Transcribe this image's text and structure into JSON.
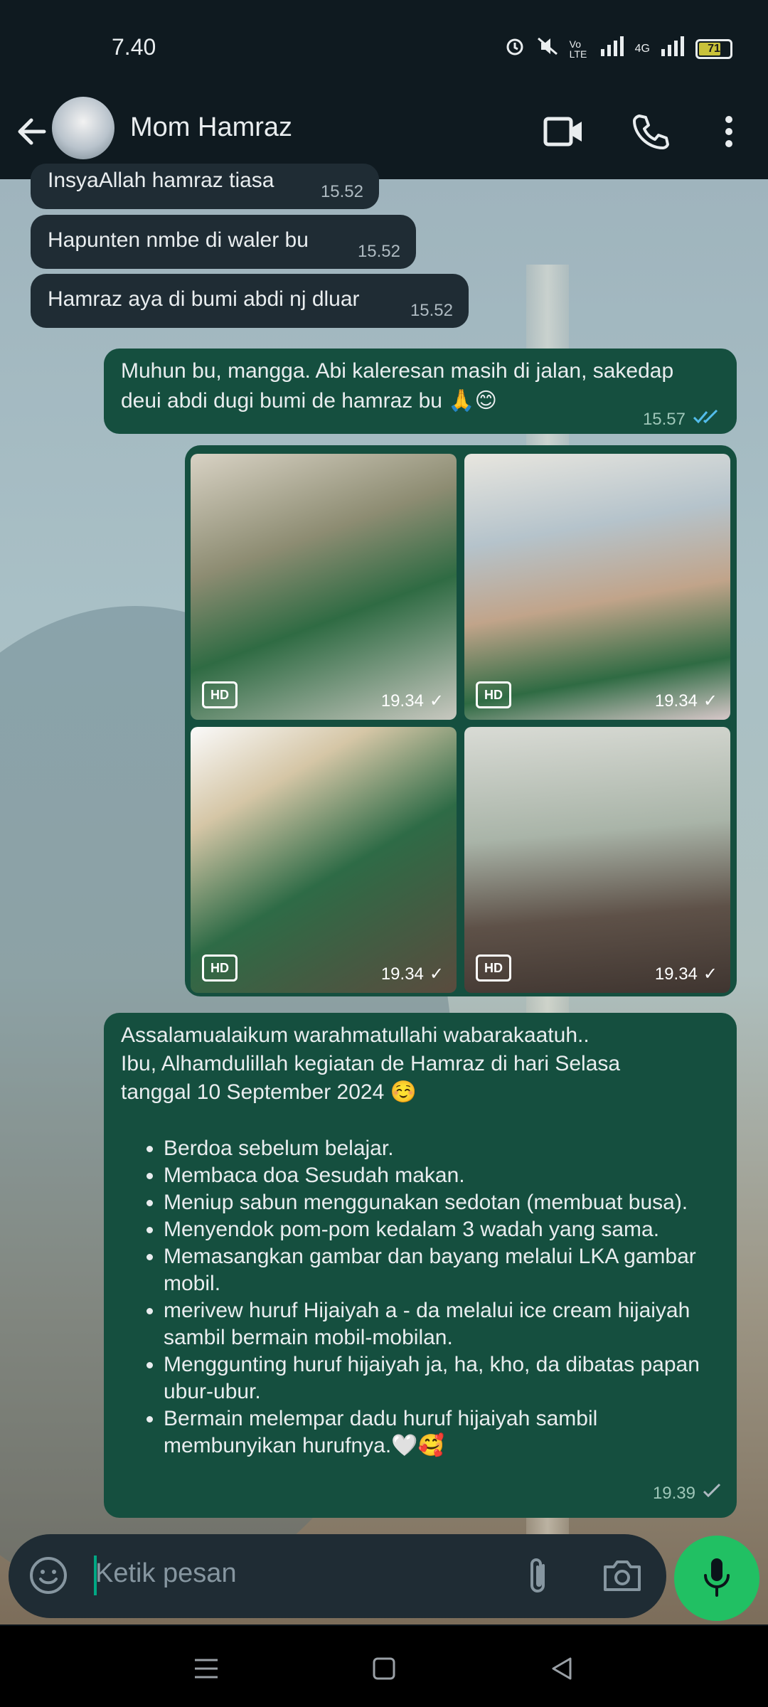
{
  "status": {
    "time": "7.40",
    "network_label": "4G",
    "volte_label": "Vo LTE",
    "battery": "71"
  },
  "header": {
    "contact_name": "Mom Hamraz"
  },
  "messages": [
    {
      "id": "m0",
      "text": "InsyaAllah hamraz tiasa",
      "time": "15.52"
    },
    {
      "id": "m1",
      "text": "Hapunten nmbe di waler bu",
      "time": "15.52"
    },
    {
      "id": "m2",
      "text": "Hamraz aya di bumi abdi nj dluar",
      "time": "15.52"
    },
    {
      "id": "m3",
      "line1": "Muhun bu, mangga. Abi kaleresan masih di jalan, sakedap",
      "line2": "deui abdi dugi bumi de hamraz bu 🙏😊",
      "time": "15.57"
    }
  ],
  "images": [
    {
      "badge": "HD",
      "time": "19.34"
    },
    {
      "badge": "HD",
      "time": "19.34"
    },
    {
      "badge": "HD",
      "time": "19.34"
    },
    {
      "badge": "HD",
      "time": "19.34"
    }
  ],
  "report": {
    "line1": "Assalamualaikum warahmatullahi wabarakaatuh..",
    "line2": "Ibu, Alhamdulillah kegiatan de Hamraz di hari Selasa",
    "line3": "tanggal 10 September 2024 ☺️",
    "items": [
      "Berdoa sebelum belajar.",
      "Membaca doa Sesudah makan.",
      "Meniup sabun menggunakan sedotan (membuat busa).",
      "Menyendok pom-pom kedalam 3 wadah yang sama.",
      "Memasangkan gambar dan bayang melalui LKA gambar mobil.",
      "merivew huruf Hijaiyah a - da melalui ice cream hijaiyah sambil bermain mobil-mobilan.",
      "Menggunting huruf hijaiyah ja, ha, kho, da dibatas papan ubur-ubur.",
      "Bermain melempar dadu huruf hijaiyah sambil membunyikan hurufnya.🤍🥰"
    ],
    "time": "19.39"
  },
  "composer": {
    "placeholder": "Ketik pesan"
  }
}
